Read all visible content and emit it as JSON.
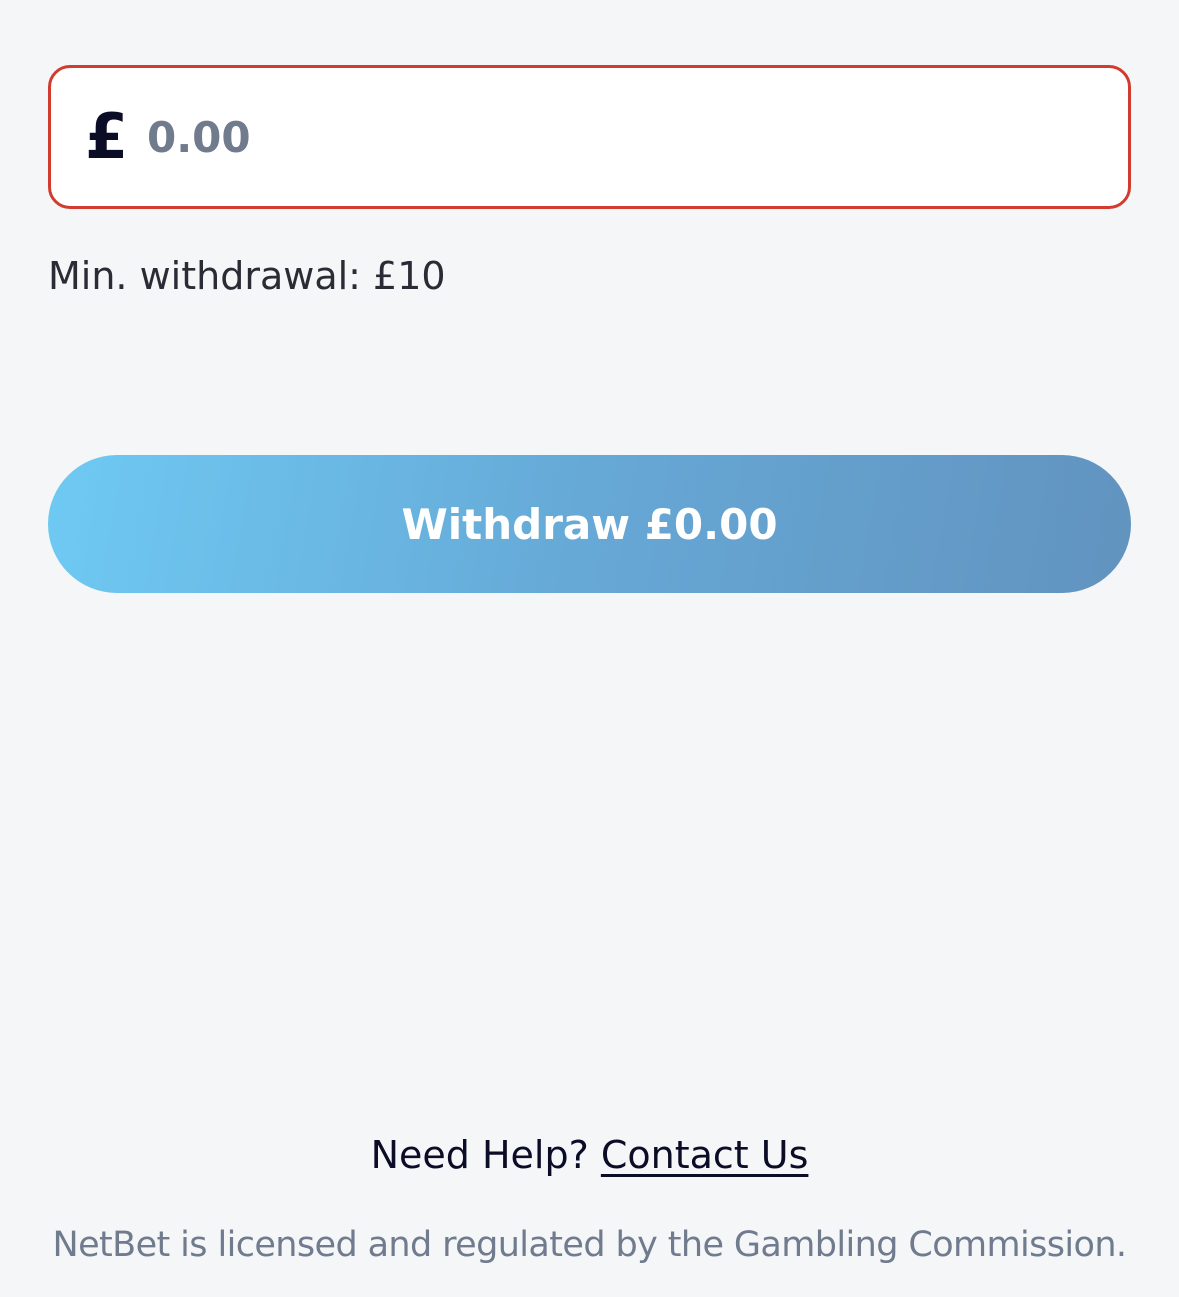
{
  "withdraw_form": {
    "currency_symbol": "£",
    "amount_placeholder": "0.00",
    "min_withdrawal_text": "Min. withdrawal: £10",
    "withdraw_button_label": "Withdraw £0.00"
  },
  "footer": {
    "help_prompt": "Need Help?",
    "contact_link": "Contact Us",
    "license_text": "NetBet is licensed and regulated by the Gambling Commission."
  },
  "colors": {
    "background": "#f4f6f8",
    "error_border": "#d23c2f",
    "button_gradient_start": "#6ecaf3",
    "button_gradient_end": "#6293bf",
    "muted_text": "#717b8e",
    "dark_text": "#0b0c26"
  }
}
